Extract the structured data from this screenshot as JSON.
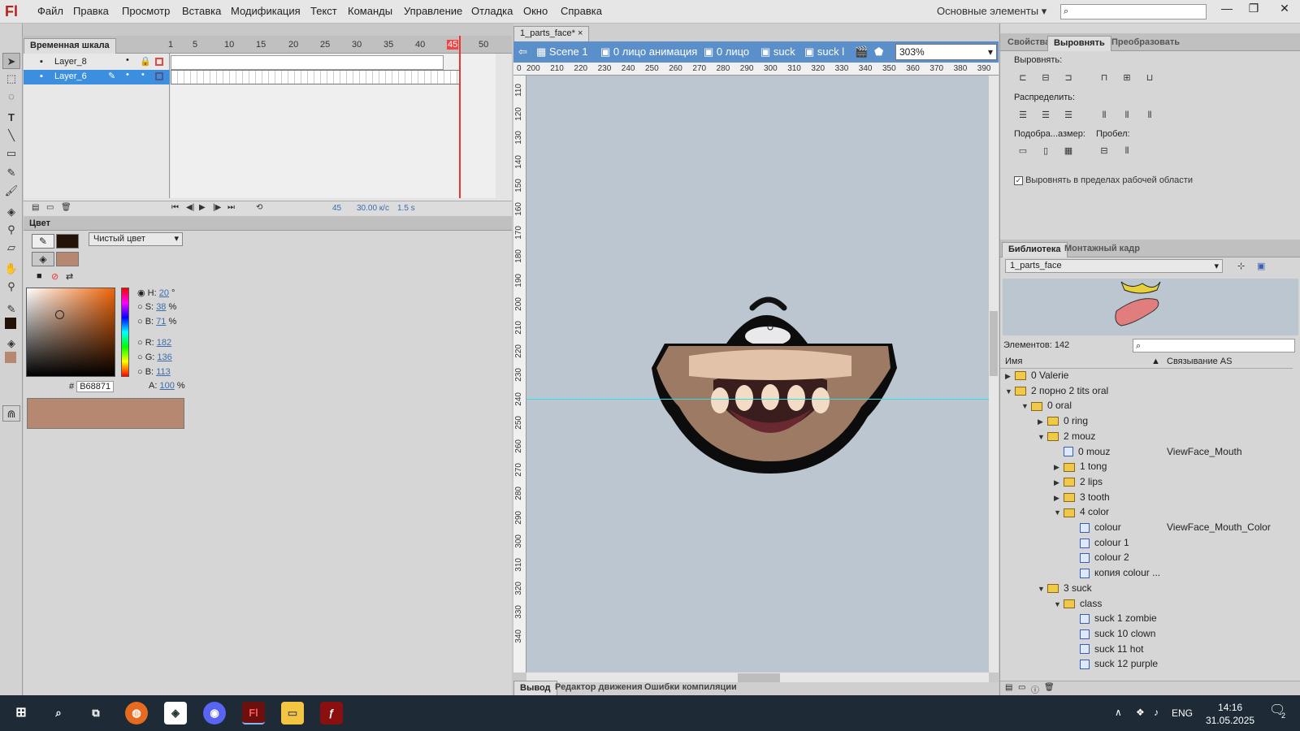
{
  "app": {
    "logo": "Fl",
    "workspace": "Основные элементы"
  },
  "menu": [
    "Файл",
    "Правка",
    "Просмотр",
    "Вставка",
    "Модификация",
    "Текст",
    "Команды",
    "Управление",
    "Отладка",
    "Окно",
    "Справка"
  ],
  "window_controls": {
    "minimize": "—",
    "restore": "❐",
    "close": "✕"
  },
  "timeline": {
    "tab": "Временная шкала",
    "layers": [
      {
        "name": "Layer_8"
      },
      {
        "name": "Layer_6"
      }
    ],
    "frame_numbers": [
      "1",
      "5",
      "10",
      "15",
      "20",
      "25",
      "30",
      "35",
      "40",
      "45",
      "50"
    ],
    "current_frame": "45",
    "fps": "30.00 к/с",
    "time": "1.5 s"
  },
  "color": {
    "tab": "Цвет",
    "fill_type": "Чистый цвет",
    "h": "20",
    "h_unit": "°",
    "s": "38",
    "s_unit": "%",
    "b": "71",
    "b_unit": "%",
    "r": "182",
    "g": "136",
    "bl": "113",
    "alpha": "100",
    "alpha_unit": "%",
    "hex": "B68871",
    "labels": {
      "h": "H:",
      "s": "S:",
      "b": "B:",
      "r": "R:",
      "g": "G:",
      "bl": "B:",
      "a": "A:",
      "hash": "#"
    },
    "stroke_color": "#231208",
    "fill_color": "#b68871"
  },
  "document": {
    "tab": "1_parts_face*",
    "close": "×",
    "breadcrumbs": [
      "Scene 1",
      "0 лицо анимация",
      "0 лицо",
      "suck",
      "suck lip"
    ],
    "zoom": "303%",
    "ruler_top": [
      "0",
      "200",
      "210",
      "220",
      "230",
      "240",
      "250",
      "260",
      "270",
      "280",
      "290",
      "300",
      "310",
      "320",
      "330",
      "340",
      "350",
      "360",
      "370",
      "380",
      "390"
    ],
    "ruler_left": [
      "110",
      "120",
      "130",
      "140",
      "150",
      "160",
      "170",
      "180",
      "190",
      "200",
      "210",
      "220",
      "230",
      "240",
      "250",
      "260",
      "270",
      "280",
      "290",
      "300",
      "310",
      "320",
      "330",
      "340"
    ],
    "output_tabs": [
      "Вывод",
      "Редактор движения",
      "Ошибки компиляции"
    ]
  },
  "right": {
    "tabs": [
      "Свойства",
      "Выровнять",
      "Преобразовать"
    ],
    "align_label": "Выровнять:",
    "distribute_label": "Распределить:",
    "match_label": "Подобра...азмер:",
    "space_label": "Пробел:",
    "stage_check": "Выровнять в пределах рабочей области"
  },
  "library": {
    "tabs": [
      "Библиотека",
      "Монтажный кадр"
    ],
    "doc": "1_parts_face",
    "count": "Элементов: 142",
    "col_name": "Имя",
    "col_link": "Связывание AS",
    "items": [
      {
        "label": "0 Valerie",
        "type": "folder",
        "depth": 0,
        "arrow": "▶",
        "link": ""
      },
      {
        "label": "2 порно 2 tits oral",
        "type": "folder",
        "depth": 0,
        "arrow": "▼",
        "link": ""
      },
      {
        "label": "0 oral",
        "type": "folder",
        "depth": 1,
        "arrow": "▼",
        "link": ""
      },
      {
        "label": "0 ring",
        "type": "folder",
        "depth": 2,
        "arrow": "▶",
        "link": ""
      },
      {
        "label": "2 mouz",
        "type": "folder",
        "depth": 2,
        "arrow": "▼",
        "link": ""
      },
      {
        "label": "0 mouz",
        "type": "symbol",
        "depth": 3,
        "arrow": "",
        "link": "ViewFace_Mouth"
      },
      {
        "label": "1 tong",
        "type": "folder",
        "depth": 3,
        "arrow": "▶",
        "link": ""
      },
      {
        "label": "2 lips",
        "type": "folder",
        "depth": 3,
        "arrow": "▶",
        "link": ""
      },
      {
        "label": "3 tooth",
        "type": "folder",
        "depth": 3,
        "arrow": "▶",
        "link": ""
      },
      {
        "label": "4 color",
        "type": "folder",
        "depth": 3,
        "arrow": "▼",
        "link": ""
      },
      {
        "label": "colour",
        "type": "symbol",
        "depth": 4,
        "arrow": "",
        "link": "ViewFace_Mouth_Color"
      },
      {
        "label": "colour 1",
        "type": "symbol",
        "depth": 4,
        "arrow": "",
        "link": ""
      },
      {
        "label": "colour 2",
        "type": "symbol",
        "depth": 4,
        "arrow": "",
        "link": ""
      },
      {
        "label": "копия colour ...",
        "type": "symbol",
        "depth": 4,
        "arrow": "",
        "link": ""
      },
      {
        "label": "3 suck",
        "type": "folder",
        "depth": 2,
        "arrow": "▼",
        "link": ""
      },
      {
        "label": "class",
        "type": "folder",
        "depth": 3,
        "arrow": "▼",
        "link": ""
      },
      {
        "label": "suck 1 zombie",
        "type": "symbol",
        "depth": 4,
        "arrow": "",
        "link": ""
      },
      {
        "label": "suck 10 clown",
        "type": "symbol",
        "depth": 4,
        "arrow": "",
        "link": ""
      },
      {
        "label": "suck 11 hot",
        "type": "symbol",
        "depth": 4,
        "arrow": "",
        "link": ""
      },
      {
        "label": "suck 12 purple",
        "type": "symbol",
        "depth": 4,
        "arrow": "",
        "link": ""
      }
    ]
  },
  "taskbar": {
    "lang": "ENG",
    "time": "14:16",
    "date": "31.05.2025",
    "notifications": "2"
  }
}
